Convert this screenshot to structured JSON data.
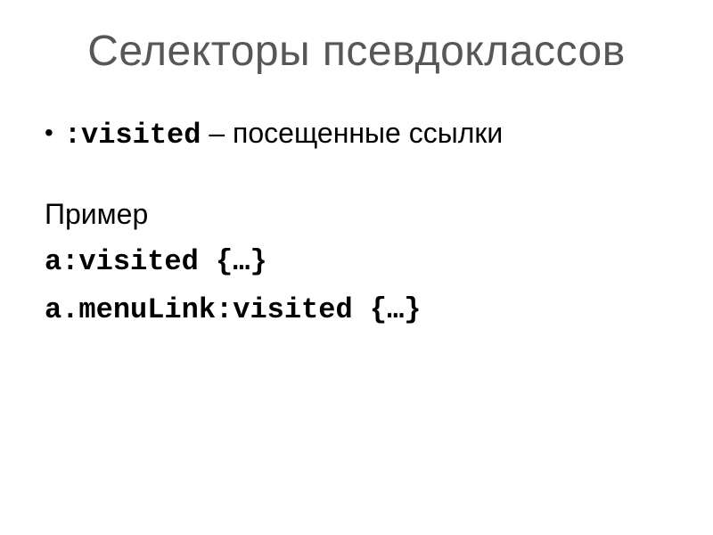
{
  "slide": {
    "title": "Селекторы псевдоклассов",
    "bullet": {
      "selector": ":visited",
      "separator": " – ",
      "description": "посещенные ссылки"
    },
    "example_label": "Пример",
    "code": {
      "line1": "a:visited {…}",
      "line2": "a.menuLink:visited {…}"
    }
  }
}
